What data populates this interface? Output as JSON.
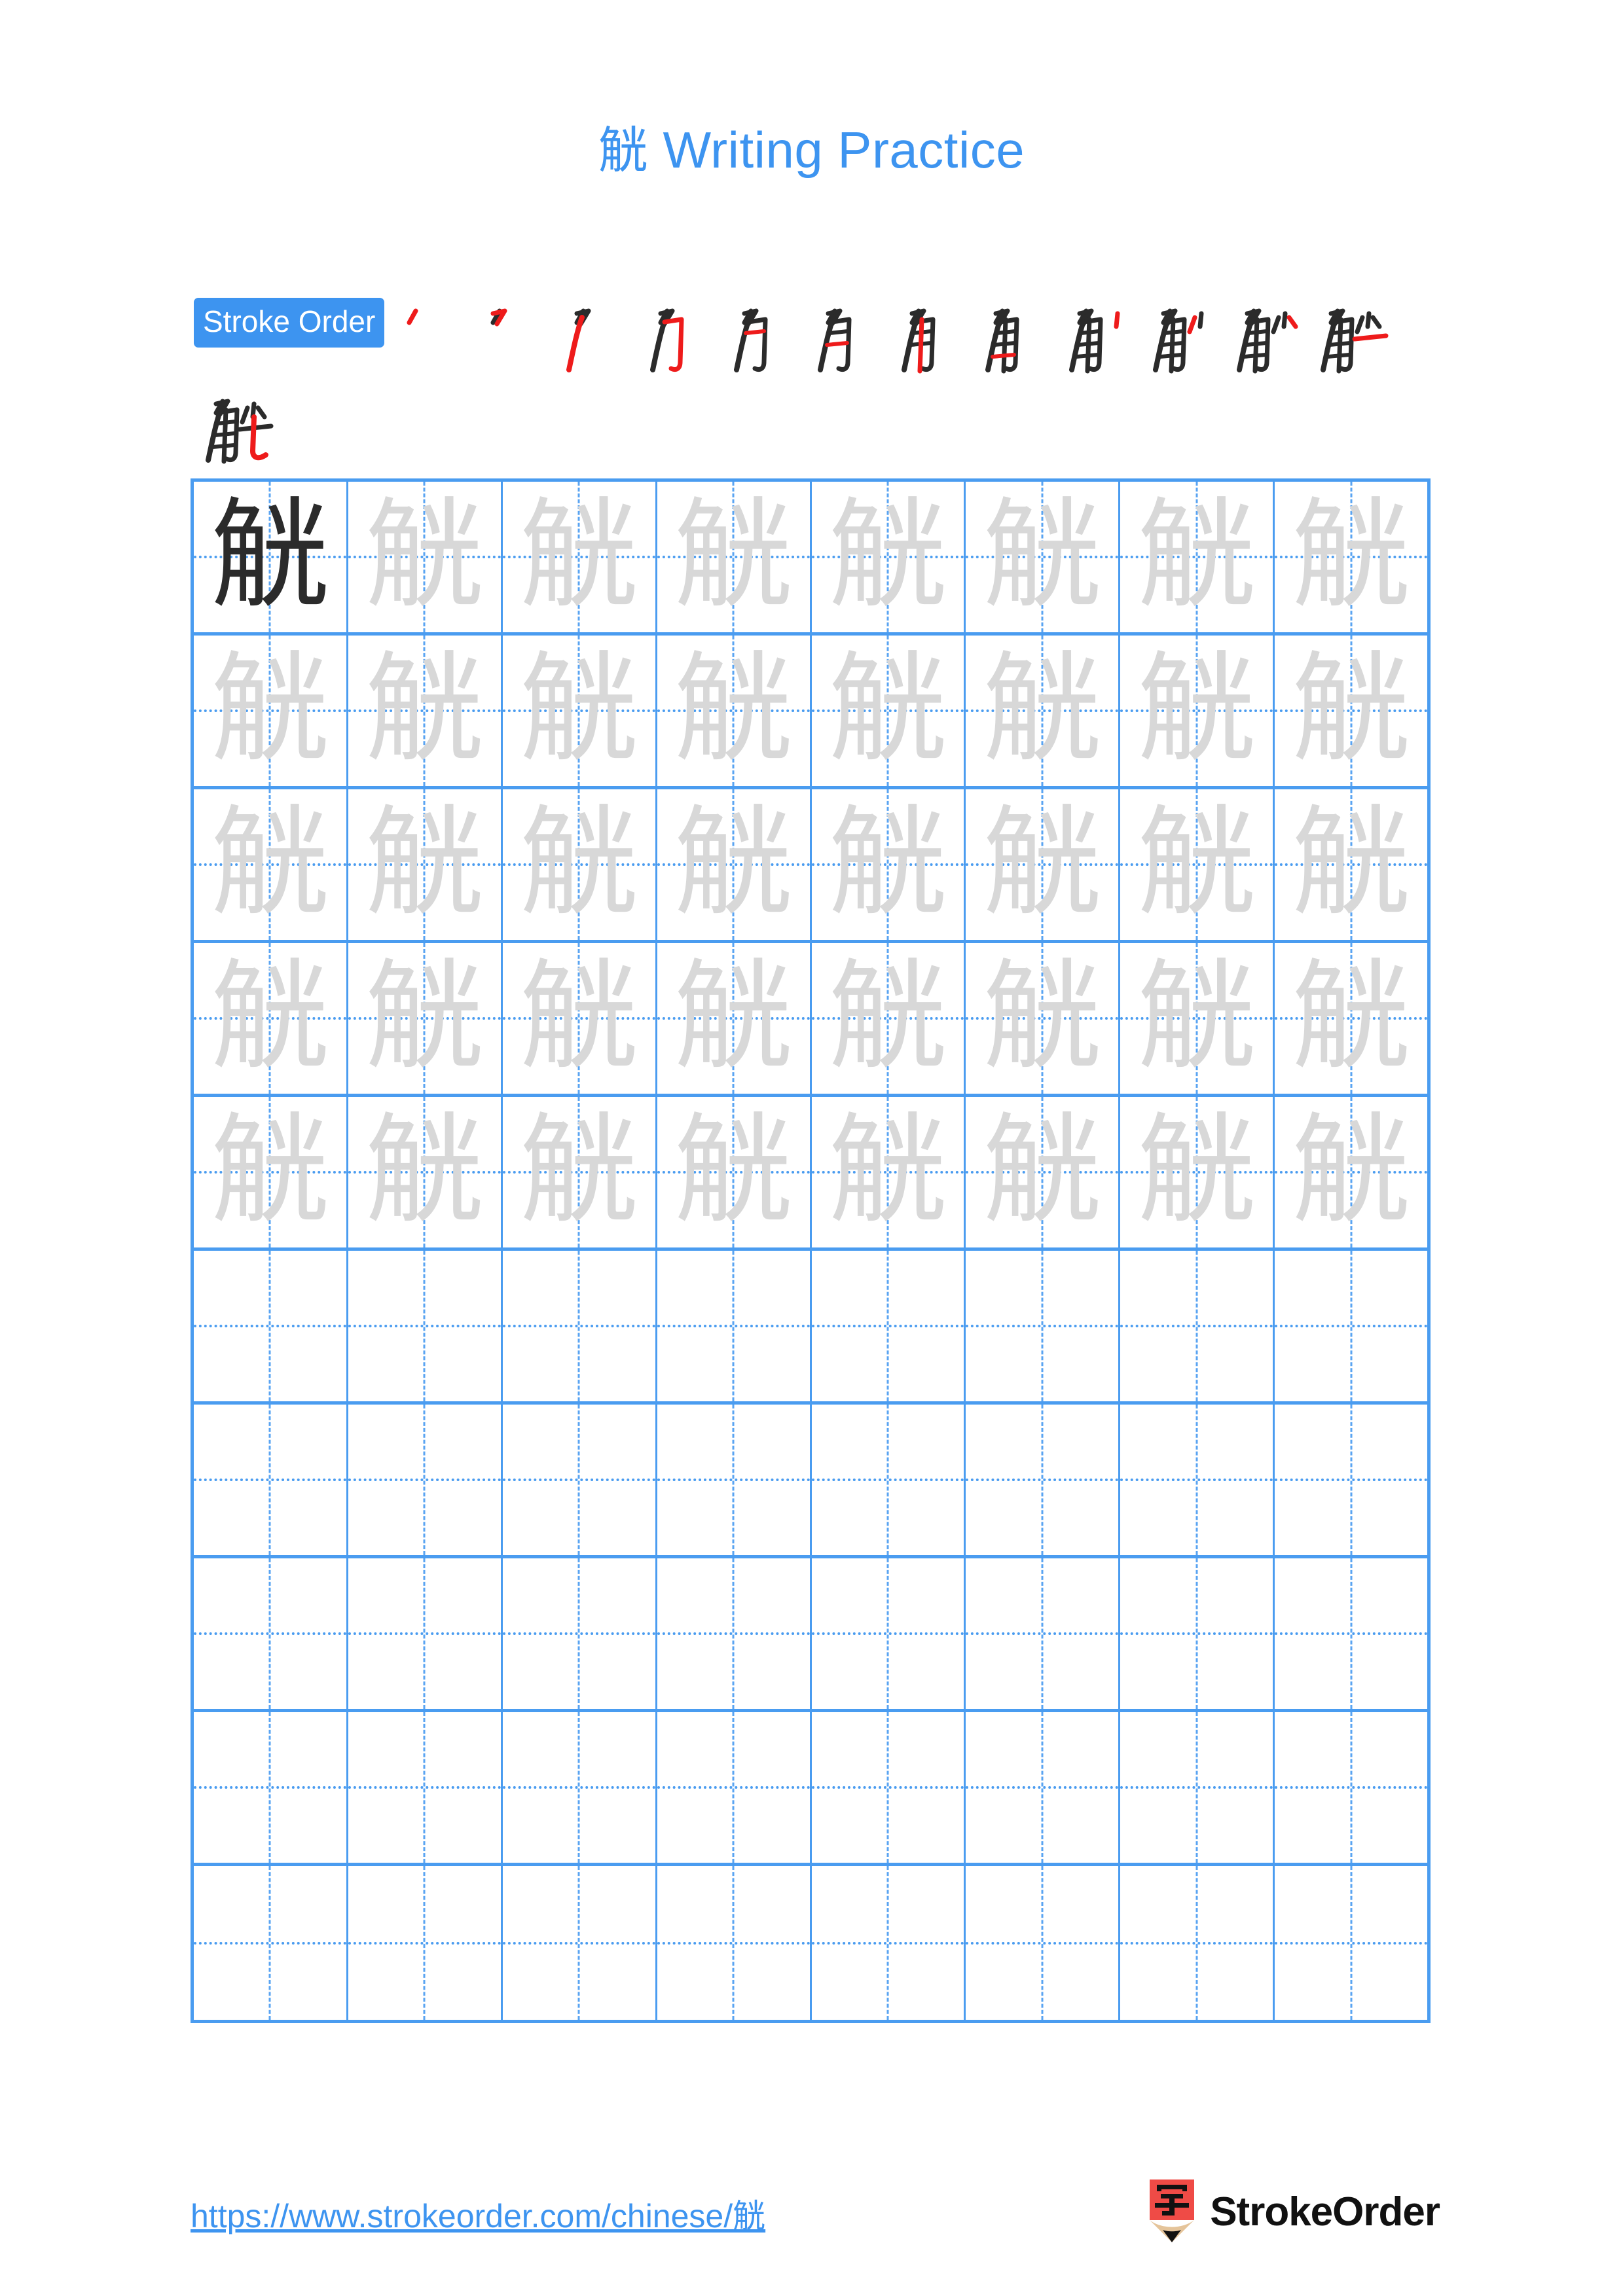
{
  "page": {
    "character": "觥",
    "title_suffix": " Writing Practice",
    "title_full": "觥 Writing Practice",
    "background_color": "#ffffff",
    "accent_color": "#3d94f0",
    "grid_line_color": "#4a9cf0",
    "model_char_color": "#2b2b2b",
    "ghost_char_color": "#d8d8d8",
    "new_stroke_color": "#ee1b1b",
    "existing_stroke_color": "#2b2b2b"
  },
  "stroke_order": {
    "badge_label": "Stroke Order",
    "total_strokes": 13,
    "steps": [
      {
        "index": 1,
        "strokes_shown": 1,
        "new_stroke": "撇 (piě)"
      },
      {
        "index": 2,
        "strokes_shown": 2,
        "new_stroke": "横撇 (héng piě)"
      },
      {
        "index": 3,
        "strokes_shown": 3,
        "new_stroke": "撇 (piě)"
      },
      {
        "index": 4,
        "strokes_shown": 4,
        "new_stroke": "横折钩 (héng zhé gōu)"
      },
      {
        "index": 5,
        "strokes_shown": 5,
        "new_stroke": "横 (héng)"
      },
      {
        "index": 6,
        "strokes_shown": 6,
        "new_stroke": "横 (héng)"
      },
      {
        "index": 7,
        "strokes_shown": 7,
        "new_stroke": "竖 (shù)"
      },
      {
        "index": 8,
        "strokes_shown": 8,
        "new_stroke": "竖 (shù)"
      },
      {
        "index": 9,
        "strokes_shown": 9,
        "new_stroke": "点 (diǎn)"
      },
      {
        "index": 10,
        "strokes_shown": 10,
        "new_stroke": "撇 (piě)"
      },
      {
        "index": 11,
        "strokes_shown": 11,
        "new_stroke": "横 (héng)"
      },
      {
        "index": 12,
        "strokes_shown": 12,
        "new_stroke": "竖弯钩 (shù wān gōu)"
      },
      {
        "index": 13,
        "strokes_shown": 13,
        "new_stroke": "竖弯钩 (shù wān gōu)"
      }
    ]
  },
  "practice_grid": {
    "columns": 8,
    "rows": 10,
    "filled_rows": 5,
    "blank_rows": 5,
    "model_cell": {
      "row": 1,
      "column": 1,
      "character": "觥"
    },
    "ghost_character": "觥"
  },
  "footer": {
    "url": "https://www.strokeorder.com/chinese/觥",
    "brand_name": "StrokeOrder",
    "logo_character": "字",
    "logo_body_color": "#ef4b46",
    "logo_wood_color": "#e5c49a",
    "logo_tip_color": "#111111"
  }
}
